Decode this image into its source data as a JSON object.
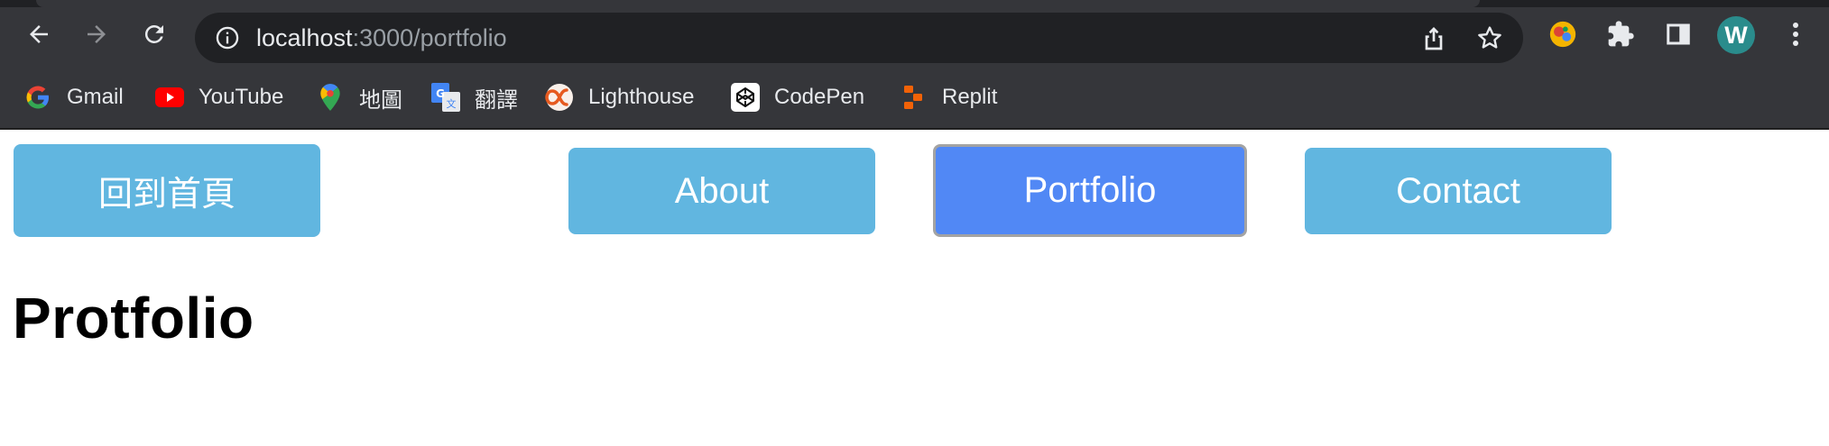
{
  "browser": {
    "url_host": "localhost",
    "url_rest": ":3000/portfolio",
    "avatar_letter": "W"
  },
  "bookmarks": [
    {
      "label": "Gmail",
      "icon": "gmail-icon"
    },
    {
      "label": "YouTube",
      "icon": "youtube-icon"
    },
    {
      "label": "地圖",
      "icon": "maps-icon"
    },
    {
      "label": "翻譯",
      "icon": "translate-icon"
    },
    {
      "label": "Lighthouse",
      "icon": "lighthouse-icon"
    },
    {
      "label": "CodePen",
      "icon": "codepen-icon"
    },
    {
      "label": "Replit",
      "icon": "replit-icon"
    }
  ],
  "nav": {
    "home_label": "回到首頁",
    "about_label": "About",
    "portfolio_label": "Portfolio",
    "contact_label": "Contact",
    "active": "Portfolio"
  },
  "page": {
    "heading": "Protfolio"
  },
  "colors": {
    "nav_button": "#61b6e0",
    "nav_button_active": "#5188f5",
    "chrome_bg": "#35363a",
    "omnibox_bg": "#202124"
  }
}
